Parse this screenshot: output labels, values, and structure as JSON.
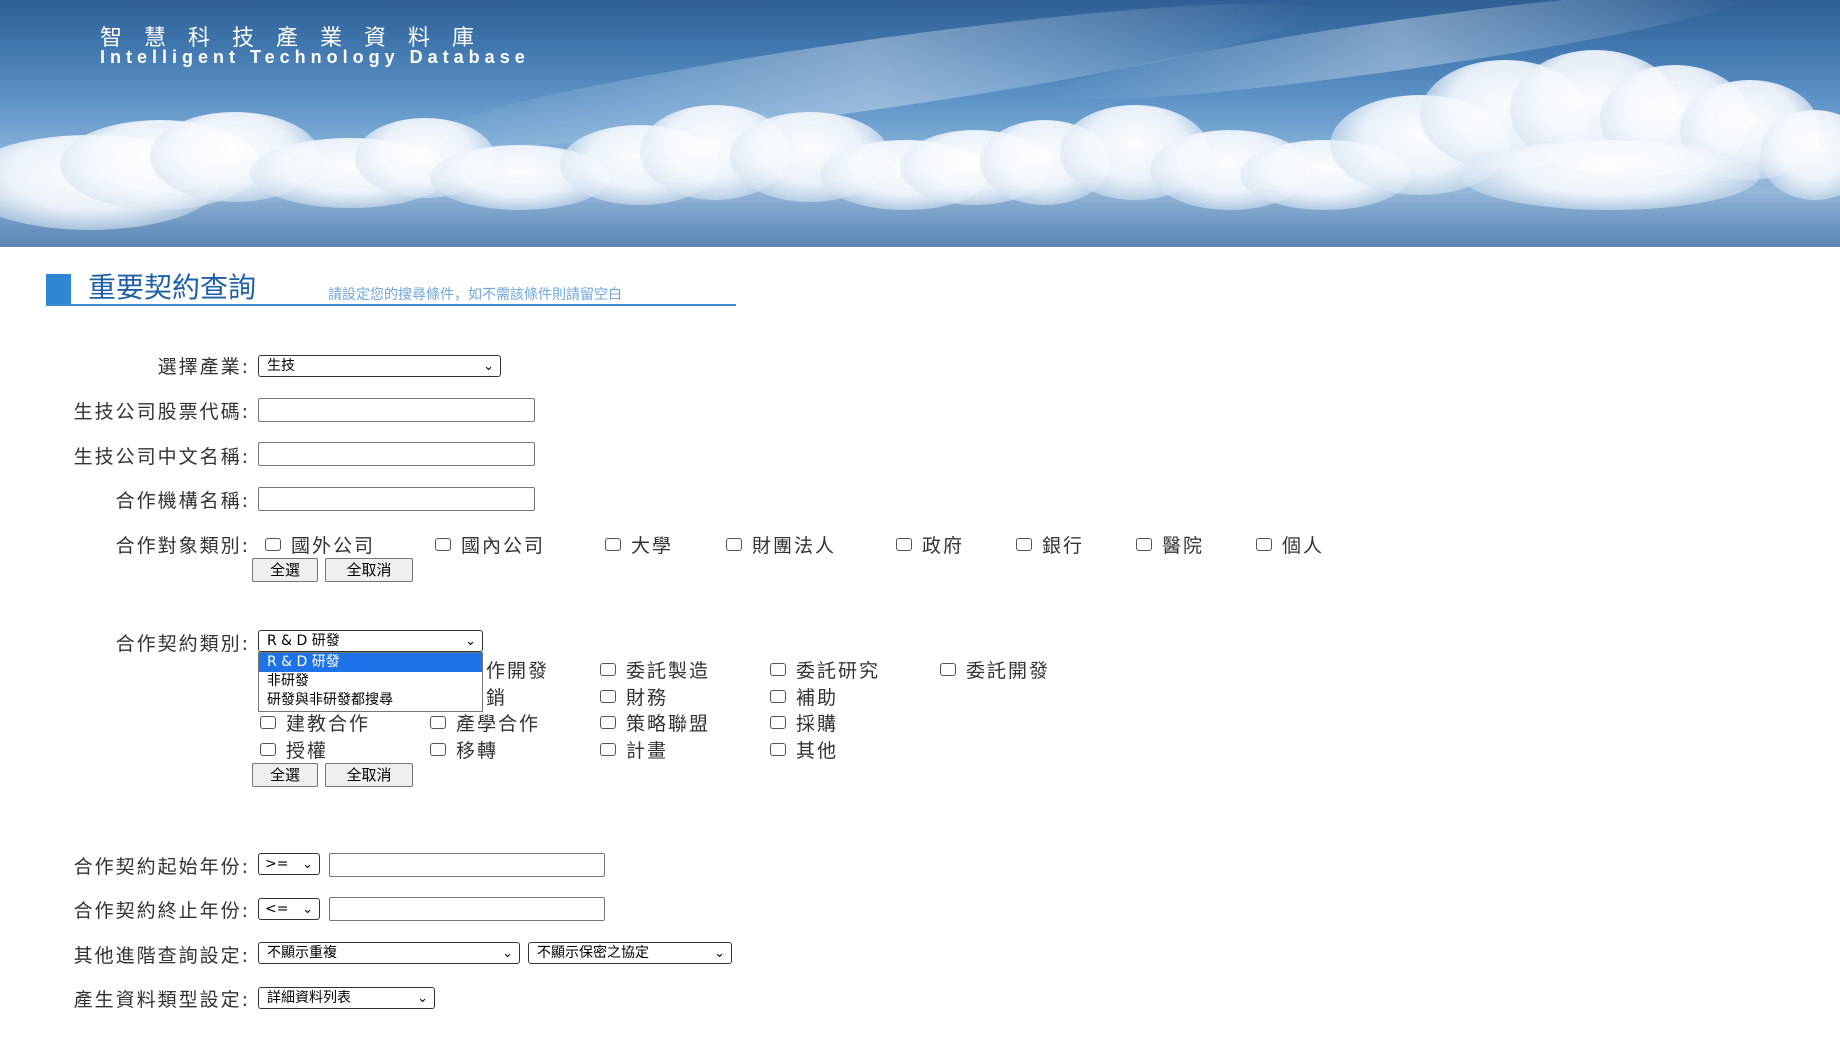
{
  "banner": {
    "title_zh": "智慧科技產業資料庫",
    "title_en": "Intelligent Technology Database"
  },
  "heading": {
    "title": "重要契約查詢",
    "hint": "請設定您的搜尋條件，如不需該條件則請留空白"
  },
  "form": {
    "industry": {
      "label": "選擇產業:",
      "value": "生技"
    },
    "stock_code": {
      "label": "生技公司股票代碼:",
      "value": ""
    },
    "company_name": {
      "label": "生技公司中文名稱:",
      "value": ""
    },
    "partner_name": {
      "label": "合作機構名稱:",
      "value": ""
    },
    "partner_type": {
      "label": "合作對象類別:",
      "options": [
        "國外公司",
        "國內公司",
        "大學",
        "財團法人",
        "政府",
        "銀行",
        "醫院",
        "個人"
      ],
      "select_all": "全選",
      "deselect_all": "全取消"
    },
    "contract_type": {
      "label": "合作契約類別:",
      "value": "R & D 研發",
      "dropdown_options": [
        "R & D 研發",
        "非研發",
        "研發與非研發都搜尋"
      ],
      "checkbox_rows": [
        [
          "作開發",
          "委託製造",
          "委託研究",
          "委託開發"
        ],
        [
          "銷",
          "財務",
          "補助"
        ],
        [
          "建教合作",
          "產學合作",
          "策略聯盟",
          "採購"
        ],
        [
          "授權",
          "移轉",
          "計畫",
          "其他"
        ]
      ],
      "select_all": "全選",
      "deselect_all": "全取消"
    },
    "start_year": {
      "label": "合作契約起始年份:",
      "operator": ">=",
      "value": ""
    },
    "end_year": {
      "label": "合作契約終止年份:",
      "operator": "<=",
      "value": ""
    },
    "advanced": {
      "label": "其他進階查詢設定:",
      "option1": "不顯示重複",
      "option2": "不顯示保密之協定"
    },
    "output_type": {
      "label": "產生資料類型設定:",
      "value": "詳細資料列表"
    }
  },
  "colors": {
    "accent": "#2f86d2",
    "heading_text": "#1f5fa5",
    "hint_text": "#6fa6db",
    "dropdown_highlight": "#1e73e8"
  }
}
